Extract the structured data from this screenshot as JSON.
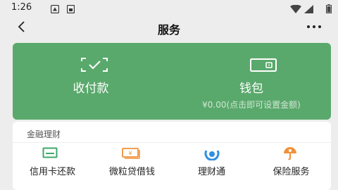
{
  "status_bar": {
    "time": "1:26",
    "icons": [
      "notification-icon",
      "sim-card-icon",
      "wifi-icon",
      "signal-icon",
      "battery-icon"
    ]
  },
  "nav": {
    "back_icon": "back-arrow-icon",
    "title": "服务",
    "more_icon": "more-dots-icon"
  },
  "top_card": {
    "color": "#5aa96c",
    "pay": {
      "label": "收付款",
      "icon": "scan-check-icon"
    },
    "wallet": {
      "label": "钱包",
      "sub": "¥0.00(点击即可设置金额)",
      "icon": "wallet-icon"
    }
  },
  "finance": {
    "header": "金融理财",
    "items": [
      {
        "label": "信用卡还款",
        "icon": "credit-card-icon",
        "color": "#3ea869"
      },
      {
        "label": "微粒贷借钱",
        "icon": "cash-icon",
        "color": "#f0913a"
      },
      {
        "label": "理财通",
        "icon": "wealth-icon",
        "color": "#2f8fe0"
      },
      {
        "label": "保险服务",
        "icon": "insurance-icon",
        "color": "#f0913a"
      }
    ]
  }
}
